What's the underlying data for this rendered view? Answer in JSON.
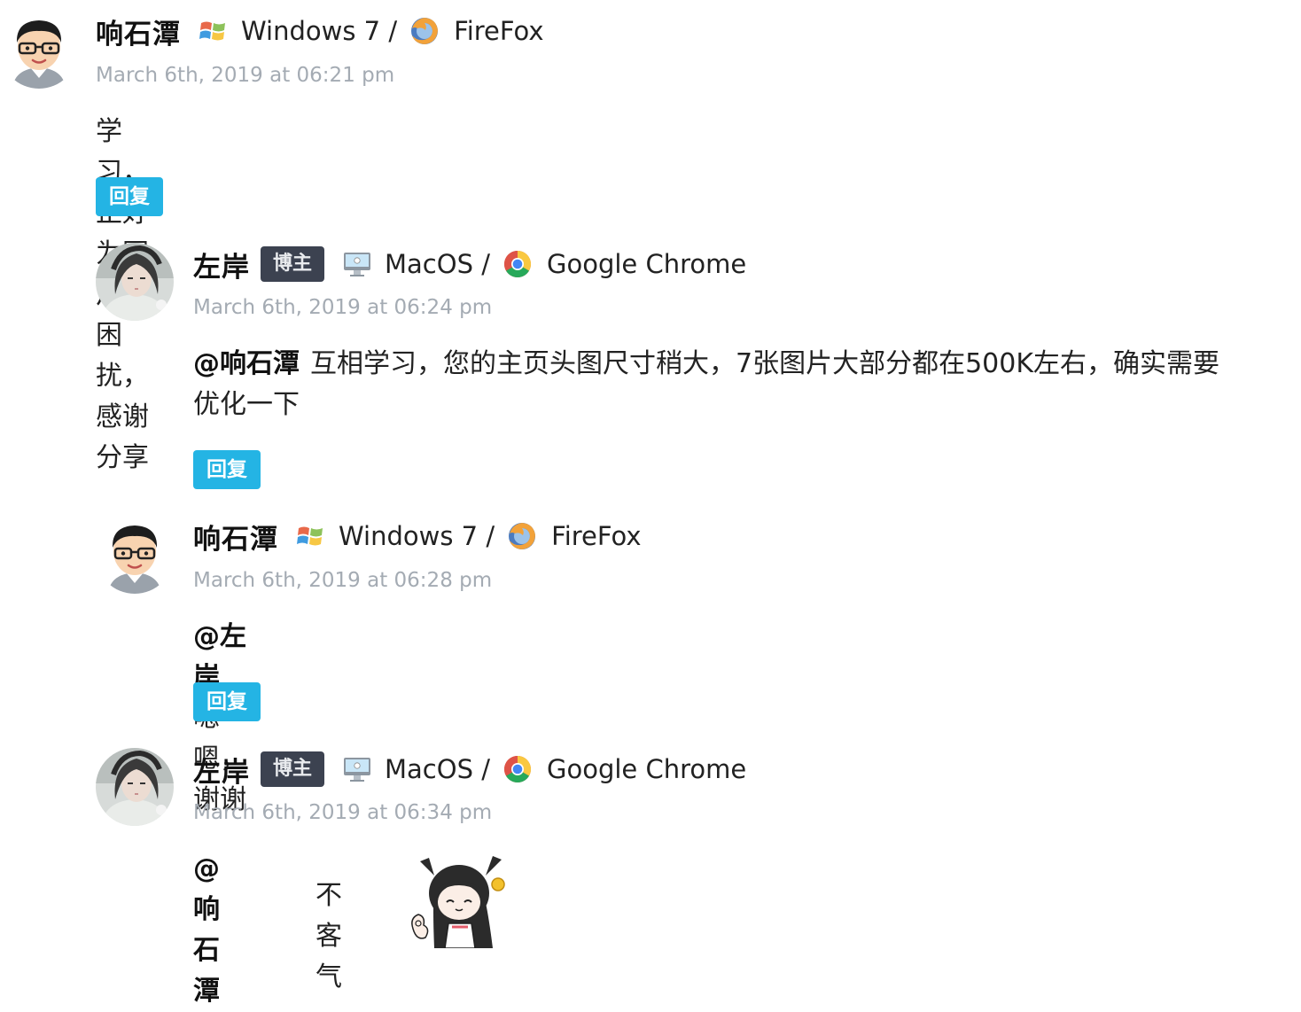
{
  "comments": [
    {
      "author": "响石潭",
      "os": "Windows 7 /",
      "browser": "FireFox",
      "date": "March 6th, 2019 at 06:21 pm",
      "text": "学习，正好为图片大困扰，感谢分享",
      "reply": "回复"
    },
    {
      "author": "左岸",
      "badge": "博主",
      "os": "MacOS /",
      "browser": "Google Chrome",
      "date": "March 6th, 2019 at 06:24 pm",
      "mention": "@响石潭",
      "text_line1": "互相学习，您的主页头图尺寸稍大，7张图片大部分都在500K左右，确实需要",
      "text_line2": "优化一下",
      "reply": "回复"
    },
    {
      "author": "响石潭",
      "os": "Windows 7 /",
      "browser": "FireFox",
      "date": "March 6th, 2019 at 06:28 pm",
      "mention": "@左岸",
      "text": "嗯嗯，谢谢",
      "reply": "回复"
    },
    {
      "author": "左岸",
      "badge": "博主",
      "os": "MacOS /",
      "browser": "Google Chrome",
      "date": "March 6th, 2019 at 06:34 pm",
      "mention": "@响石潭",
      "text": "不客气"
    }
  ],
  "icons": {
    "windows": "windows-logo-icon",
    "firefox": "firefox-icon",
    "mac": "imac-icon",
    "chrome": "chrome-icon"
  },
  "colors": {
    "reply_button": "#24b4e4",
    "badge_bg": "#3c4250",
    "date_text": "#a4abb3"
  }
}
